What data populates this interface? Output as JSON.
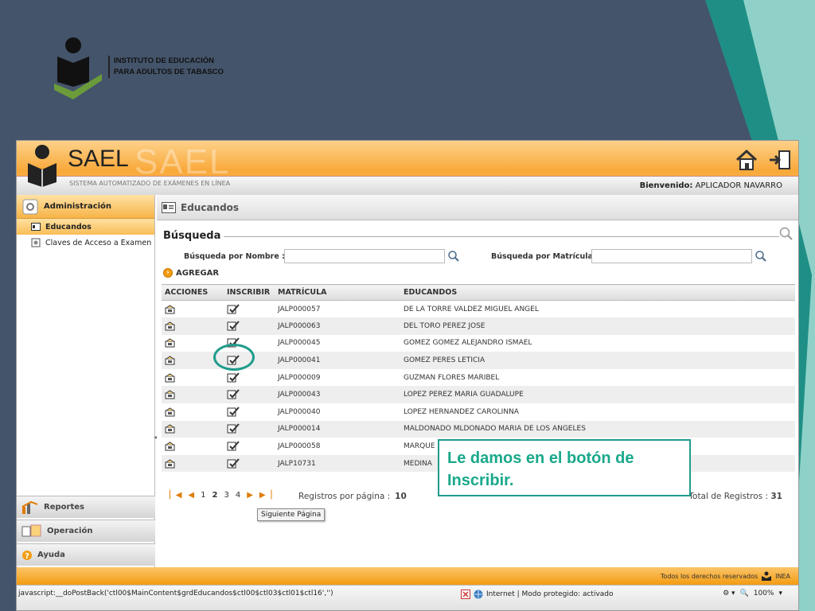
{
  "institute": {
    "name": "INSTITUTO DE EDUCACIÓN PARA ADULTOS DE TABASCO"
  },
  "app": {
    "title": "SAEL",
    "subtitle": "SISTEMA AUTOMATIZADO DE EXÁMENES EN LÍNEA",
    "welcome_label": "Bienvenido:",
    "welcome_user": "APLICADOR NAVARRO"
  },
  "sidebar": {
    "section": "Administración",
    "items": [
      {
        "label": "Educandos"
      },
      {
        "label": "Claves de Acceso a Examen"
      }
    ],
    "bottom": [
      {
        "label": "Reportes"
      },
      {
        "label": "Operación"
      },
      {
        "label": "Ayuda"
      }
    ]
  },
  "main": {
    "title": "Educandos",
    "search_title": "Búsqueda",
    "search_name_label": "Búsqueda por Nombre :",
    "search_name_value": "",
    "search_mat_label": "Búsqueda por Matrícula :",
    "search_mat_value": "",
    "add_label": "AGREGAR",
    "columns": [
      "ACCIONES",
      "INSCRIBIR",
      "MATRÍCULA",
      "EDUCANDOS"
    ],
    "rows": [
      {
        "matricula": "JALP000057",
        "nombre": "DE LA TORRE VALDEZ MIGUEL ANGEL"
      },
      {
        "matricula": "JALP000063",
        "nombre": "DEL TORO PEREZ JOSE"
      },
      {
        "matricula": "JALP000045",
        "nombre": "GOMEZ GOMEZ ALEJANDRO ISMAEL"
      },
      {
        "matricula": "JALP000041",
        "nombre": "GOMEZ PERES LETICIA"
      },
      {
        "matricula": "JALP000009",
        "nombre": "GUZMAN FLORES MARIBEL"
      },
      {
        "matricula": "JALP000043",
        "nombre": "LOPEZ PEREZ MARIA GUADALUPE"
      },
      {
        "matricula": "JALP000040",
        "nombre": "LOPEZ HERNANDEZ CAROLINNA"
      },
      {
        "matricula": "JALP000014",
        "nombre": "MALDONADO MLDONADO MARIA DE LOS ANGELES"
      },
      {
        "matricula": "JALP000058",
        "nombre": "MARQUE"
      },
      {
        "matricula": "JALP10731",
        "nombre": "MEDINA"
      }
    ],
    "pager": {
      "pages": [
        "1",
        "2",
        "3",
        "4"
      ],
      "current": "2",
      "rpp_label": "Registros por página :",
      "rpp_value": "10",
      "total_label": "Total de Registros :",
      "total_value": "31",
      "tooltip": "Siguiente Página"
    }
  },
  "callout": {
    "line1": "Le damos en el botón de",
    "line2": "Inscribir."
  },
  "footer": {
    "rights": "Todos los derechos reservados",
    "brand": "INEA"
  },
  "statusbar": {
    "js": "javascript:__doPostBack('ctl00$MainContent$grdEducandos$ctl00$ctl03$ctl01$ctl16','')",
    "zone": "Internet | Modo protegido: activado",
    "zoom": "100%"
  },
  "colors": {
    "accent": "#f39c12",
    "callout": "#1f9c8c",
    "slide_bg": "#44546a"
  }
}
